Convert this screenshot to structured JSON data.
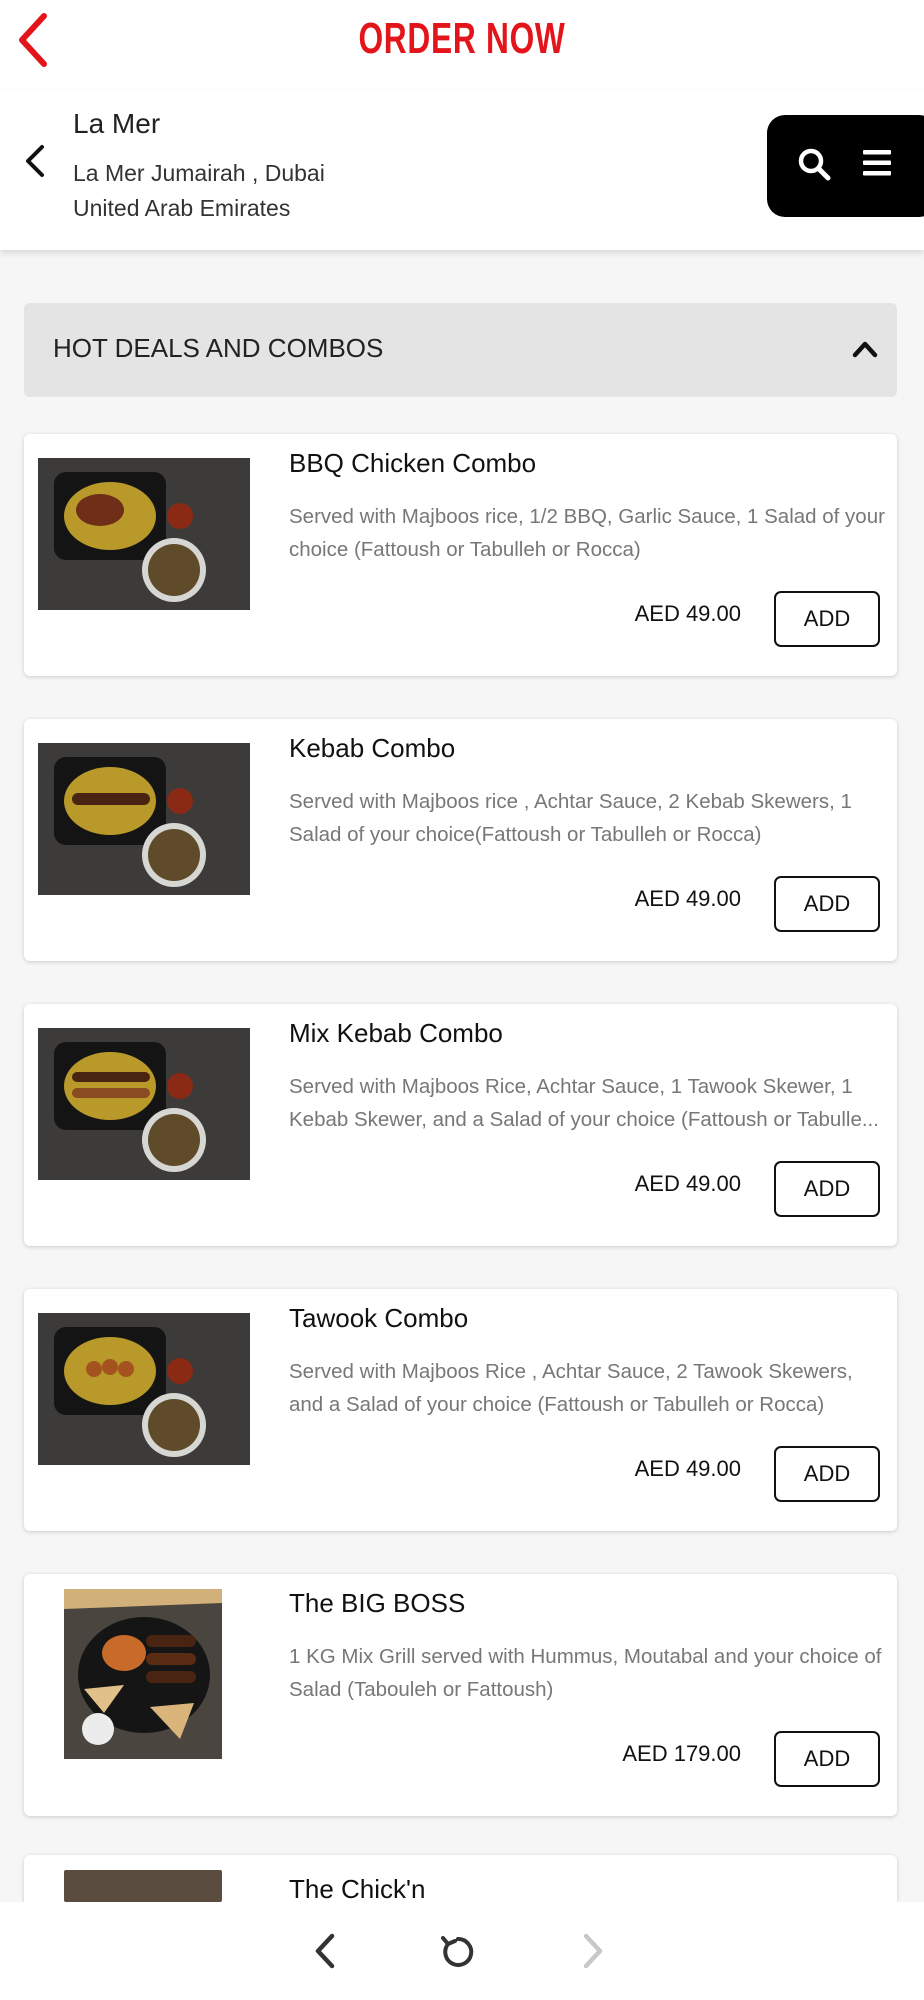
{
  "header_bar": {
    "title": "ORDER NOW",
    "accent": "#e3151b"
  },
  "location": {
    "name": "La Mer",
    "address_line1": "La Mer Jumairah , Dubai",
    "address_line2": "United Arab Emirates"
  },
  "section": {
    "title": "HOT DEALS AND COMBOS",
    "expanded": true
  },
  "items": [
    {
      "name": "BBQ Chicken Combo",
      "description": "Served with Majboos rice, 1/2 BBQ, Garlic Sauce, 1 Salad of your choice (Fattoush or Tabulleh or Rocca)",
      "price": "AED 49.00",
      "button": "ADD",
      "image": "bbq-chicken-combo-photo"
    },
    {
      "name": "Kebab Combo",
      "description": "Served with Majboos rice , Achtar Sauce, 2 Kebab Skewers, 1 Salad of your choice(Fattoush or Tabulleh or Rocca)",
      "price": "AED 49.00",
      "button": "ADD",
      "image": "kebab-combo-photo"
    },
    {
      "name": "Mix Kebab Combo",
      "description": "Served with Majboos Rice, Achtar Sauce, 1 Tawook Skewer, 1 Kebab Skewer, and a Salad of your choice (Fattoush or Tabulle... or Rocca)",
      "price": "AED 49.00",
      "button": "ADD",
      "image": "mix-kebab-combo-photo"
    },
    {
      "name": "Tawook Combo",
      "description": "Served with Majboos Rice , Achtar Sauce, 2 Tawook Skewers, and a Salad of your choice (Fattoush or Tabulleh or Rocca)",
      "price": "AED 49.00",
      "button": "ADD",
      "image": "tawook-combo-photo"
    },
    {
      "name": "The BIG BOSS",
      "description": "1 KG Mix Grill served with Hummus, Moutabal and your choice of Salad (Tabouleh or Fattoush)",
      "price": "AED 179.00",
      "button": "ADD",
      "image": "big-boss-platter-photo"
    }
  ],
  "partial_item": {
    "name": "The Chick'n"
  },
  "browser_nav": {
    "back": "back-arrow-icon",
    "reload": "reload-icon",
    "forward": "forward-arrow-icon (disabled)"
  }
}
